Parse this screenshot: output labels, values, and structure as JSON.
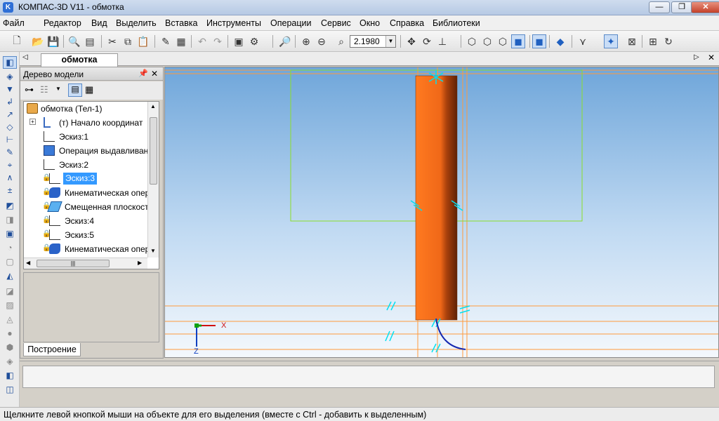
{
  "window": {
    "title": "КОМПАС-3D V11 - обмотка",
    "app_icon_letter": "K",
    "minimize": "—",
    "maximize": "❐",
    "close": "✕"
  },
  "menu": [
    "Файл",
    "Редактор",
    "Вид",
    "Выделить",
    "Вставка",
    "Инструменты",
    "Операции",
    "Сервис",
    "Окно",
    "Справка",
    "Библиотеки"
  ],
  "toolbar": {
    "zoom_value": "2.1980"
  },
  "document_tab": "обмотка",
  "tree": {
    "title": "Дерево модели",
    "items": [
      {
        "label": "обмотка (Тел-1)",
        "icon": "part-icon"
      },
      {
        "label": "(т) Начало координат",
        "icon": "origin-icon"
      },
      {
        "label": "Эскиз:1",
        "icon": "sketch-icon"
      },
      {
        "label": "Операция выдавливания",
        "icon": "extrude-icon"
      },
      {
        "label": "Эскиз:2",
        "icon": "sketch-icon"
      },
      {
        "label": "Эскиз:3",
        "icon": "sketch-icon",
        "selected": true
      },
      {
        "label": "Кинематическая операция",
        "icon": "sweep-icon"
      },
      {
        "label": "Смещенная плоскость",
        "icon": "plane-icon"
      },
      {
        "label": "Эскиз:4",
        "icon": "sketch-icon"
      },
      {
        "label": "Эскиз:5",
        "icon": "sketch-icon"
      },
      {
        "label": "Кинематическая операция",
        "icon": "sweep-icon"
      }
    ],
    "bottom_tab": "Построение"
  },
  "viewport": {
    "axis_x": "X",
    "axis_z": "Z",
    "colors": {
      "part": "#ff7a1f",
      "construction_line": "#ff9a3c",
      "sketch_frame": "#8adf2a",
      "dimension_marks": "#00e0f0",
      "path_curve": "#1428b0"
    }
  },
  "status": {
    "hint": "Щелкните левой кнопкой мыши на объекте для его выделения (вместе с Ctrl - добавить к выделенным)"
  }
}
